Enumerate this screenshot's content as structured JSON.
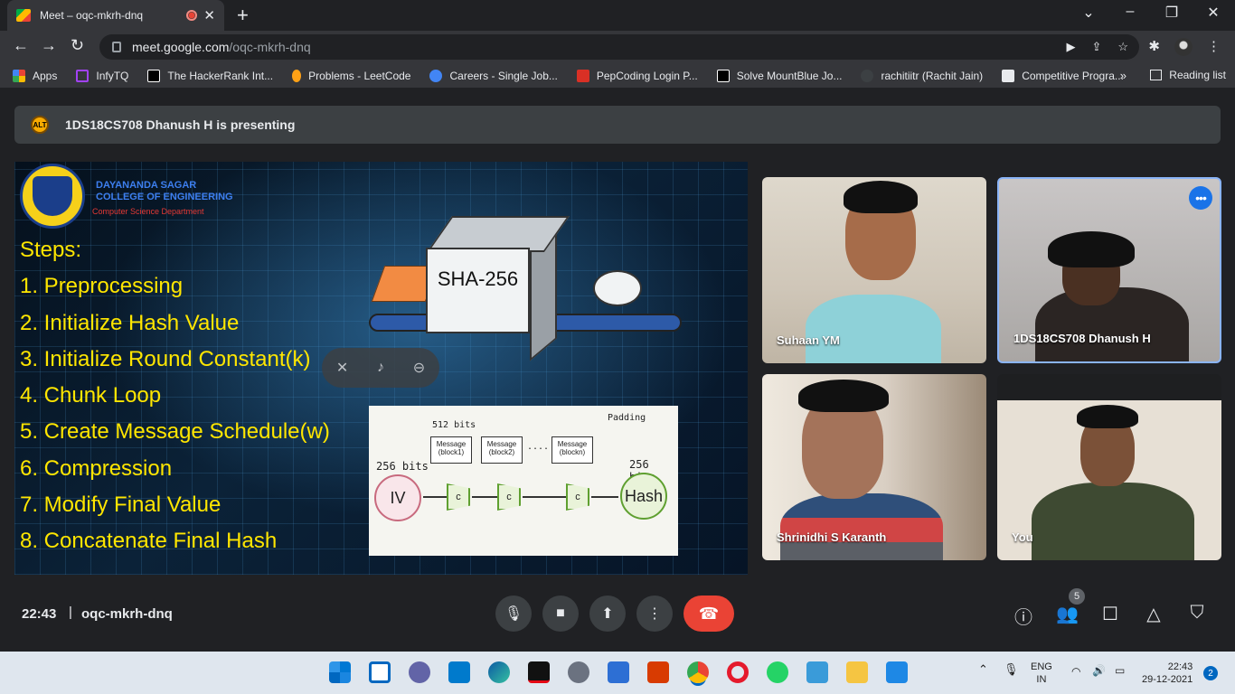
{
  "browser": {
    "tab_title": "Meet – oqc-mkrh-dnq",
    "url_host": "meet.google.com",
    "url_path": "/oqc-mkrh-dnq",
    "bookmarks": [
      {
        "label": "Apps",
        "color": "#f28b82"
      },
      {
        "label": "InfyTQ",
        "color": "#a142f4"
      },
      {
        "label": "The HackerRank Int...",
        "color": "#ffffff"
      },
      {
        "label": "Problems - LeetCode",
        "color": "#ffa116"
      },
      {
        "label": "Careers - Single Job...",
        "color": "#4285f4"
      },
      {
        "label": "PepCoding Login P...",
        "color": "#d93025"
      },
      {
        "label": "Solve MountBlue Jo...",
        "color": "#ffffff"
      },
      {
        "label": "rachitiitr (Rachit Jain)",
        "color": "#3c4043"
      },
      {
        "label": "Competitive Progra...",
        "color": "#e8eaed"
      }
    ],
    "more_bookmarks": "»",
    "reading_list": "Reading list"
  },
  "meeting": {
    "presenting_text": "1DS18CS708 Dhanush H is presenting",
    "presenter_badge": "ALT",
    "time": "22:43",
    "separator": "|",
    "code": "oqc-mkrh-dnq",
    "participant_count": "5",
    "participants": [
      {
        "name": "Suhaan YM"
      },
      {
        "name": "1DS18CS708 Dhanush H"
      },
      {
        "name": "Shrinidhi S Karanth"
      },
      {
        "name": "You"
      }
    ]
  },
  "slide": {
    "college_line1": "DAYANANDA SAGAR",
    "college_line2": "COLLEGE OF ENGINEERING",
    "department": "Computer Science Department",
    "steps": [
      "Steps:",
      "1. Preprocessing",
      "2. Initialize Hash Value",
      "3. Initialize Round Constant(k)",
      "4. Chunk Loop",
      "5. Create Message Schedule(w)",
      "6. Compression",
      "7. Modify Final Value",
      "8. Concatenate Final Hash"
    ],
    "sha_label": "SHA-256",
    "diagram": {
      "bits_512": "512 bits",
      "padding": "Padding",
      "bits_in": "256 bits",
      "bits_out": "256 bits",
      "msg1": "Message (block1)",
      "msg2": "Message (block2)",
      "dots": "....",
      "msgn": "Message (blockn)",
      "iv": "IV",
      "c": "c",
      "hash": "Hash"
    }
  },
  "taskbar": {
    "lang1": "ENG",
    "lang2": "IN",
    "time": "22:43",
    "date": "29-12-2021",
    "notifications": "2"
  }
}
